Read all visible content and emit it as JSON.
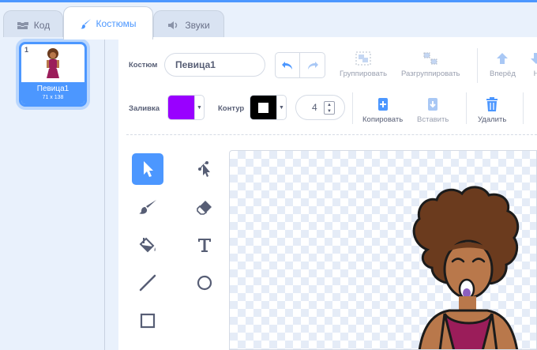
{
  "tabs": [
    {
      "label": "Код",
      "icon": "code-blocks-icon"
    },
    {
      "label": "Костюмы",
      "icon": "brush-icon",
      "active": true
    },
    {
      "label": "Звуки",
      "icon": "speaker-icon"
    }
  ],
  "costume_list": {
    "items": [
      {
        "index": "1",
        "name": "Певица1",
        "size": "71 x 138",
        "selected": true
      }
    ]
  },
  "editor": {
    "costume_label": "Костюм",
    "costume_name": "Певица1",
    "toolbar": {
      "group_label": "Группировать",
      "ungroup_label": "Разгруппировать",
      "forward_label": "Вперёд",
      "backward_label": "Н"
    },
    "fill_label": "Заливка",
    "fill_color": "#9900ff",
    "outline_label": "Контур",
    "outline_color": "#000000",
    "outline_width": "4",
    "copy_label": "Копировать",
    "paste_label": "Вставить",
    "delete_label": "Удалить",
    "tools": [
      "select-tool",
      "reshape-tool",
      "brush-tool",
      "eraser-tool",
      "fill-tool",
      "text-tool",
      "line-tool",
      "circle-tool",
      "rectangle-tool"
    ],
    "accent_color": "#4c97ff"
  }
}
